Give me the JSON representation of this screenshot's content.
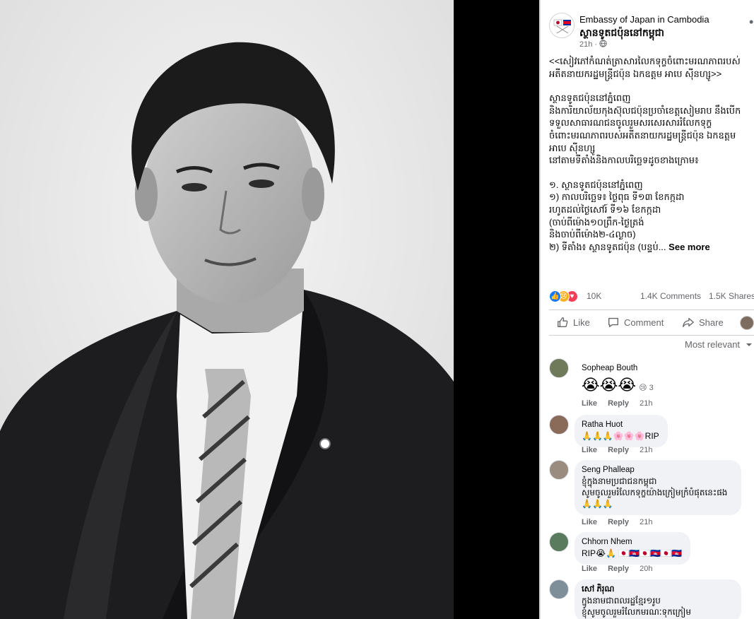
{
  "post": {
    "page_name": "Embassy of Japan in Cambodia",
    "page_name_km": "ស្ថានទូតជប៉ុននៅកម្ពុជា",
    "time": "21h ·",
    "privacy_icon": "globe-icon",
    "more_icon": "more-dots-icon",
    "title": "<<សៀវភៅកំណត់ត្រាសារលៃកទុក្ខចំពោះមរណភាពរបស់អតីតនាយករដ្ឋមន្ត្រីជប៉ុន ឯកឧត្តម អាបេ ស៊ីនហ្សូ>>",
    "para1": "ស្ថានទូតជប៉ុននៅភ្នំពេញ\nនិងការិយាល័យកុងស៊ុលជប៉ុនប្រចាំខេត្តសៀមរាប នឹងបើកទទួលសាធារណជនចូលរួមសរសេរសាររំលែកទុក្ខចំពោះមរណភាពរបស់អតីតនាយករដ្ឋមន្ត្រីជប៉ុន ឯកឧត្តម អាបេ ស៊ីនហ្សូ\nនៅតាមទីតាំងនិងកាលបរិច្ឆេទដូចខាងក្រោម៖",
    "para2": "១. ស្ថានទូតជប៉ុននៅភ្នំពេញ\n១) កាលបរិច្ឆេទ៖ ថ្ងៃពុធ ទី១៣ ខែកក្កដា\nរហូតដល់ថ្ងៃសៅរ៍ ទី១៦ ខែកក្កដា\n(ចាប់ពីម៉ោង១០ព្រឹក-ថ្ងៃត្រង់\nនិងចាប់ពីម៉ោង២-៤ល្ងាច)",
    "para3": "២) ទីតាំង៖ ស្ថានទូតជប៉ុន (បន្ទប់...",
    "see_more": "See more",
    "reaction_count": "10K",
    "comments_count": "1.4K Comments",
    "shares_count": "1.5K Shares",
    "like_label": "Like",
    "comment_label": "Comment",
    "share_label": "Share",
    "sort_label": "Most relevant"
  },
  "comments": [
    {
      "author": "Sopheap Bouth",
      "text": "",
      "emoji": "😭😭😭",
      "reactions": "3",
      "reaction_emoji": "😢",
      "like": "Like",
      "reply": "Reply",
      "time": "21h"
    },
    {
      "author": "Ratha Huot",
      "text": "🙏🙏🙏🌸🌸🌸RIP",
      "like": "Like",
      "reply": "Reply",
      "time": "21h"
    },
    {
      "author": "Seng Phalleap",
      "text": "ខ្ញុំក្នុងនាមប្រជាជនកម្ពុជា\nសូមចូលរួមរំលែកទុក្ខយ៉ាងក្រៀមក្រំបំផុតនេះផង🙏🙏🙏",
      "like": "Like",
      "reply": "Reply",
      "time": "21h"
    },
    {
      "author": "Chhorn Nhem",
      "text": "RIP😭🙏 🇯🇵🇰🇭🇯🇵🇰🇭🇯🇵🇰🇭",
      "like": "Like",
      "reply": "Reply",
      "time": "20h"
    },
    {
      "author": "សៅ ភិរុណ",
      "text": "ក្នុងនាមជាពលរដ្ឋខ្មែរ១រូប\nខ្ញុំសូមចូលរួមរំលែកមរណៈទុកក្រៀម",
      "like": "",
      "reply": "",
      "time": ""
    }
  ]
}
